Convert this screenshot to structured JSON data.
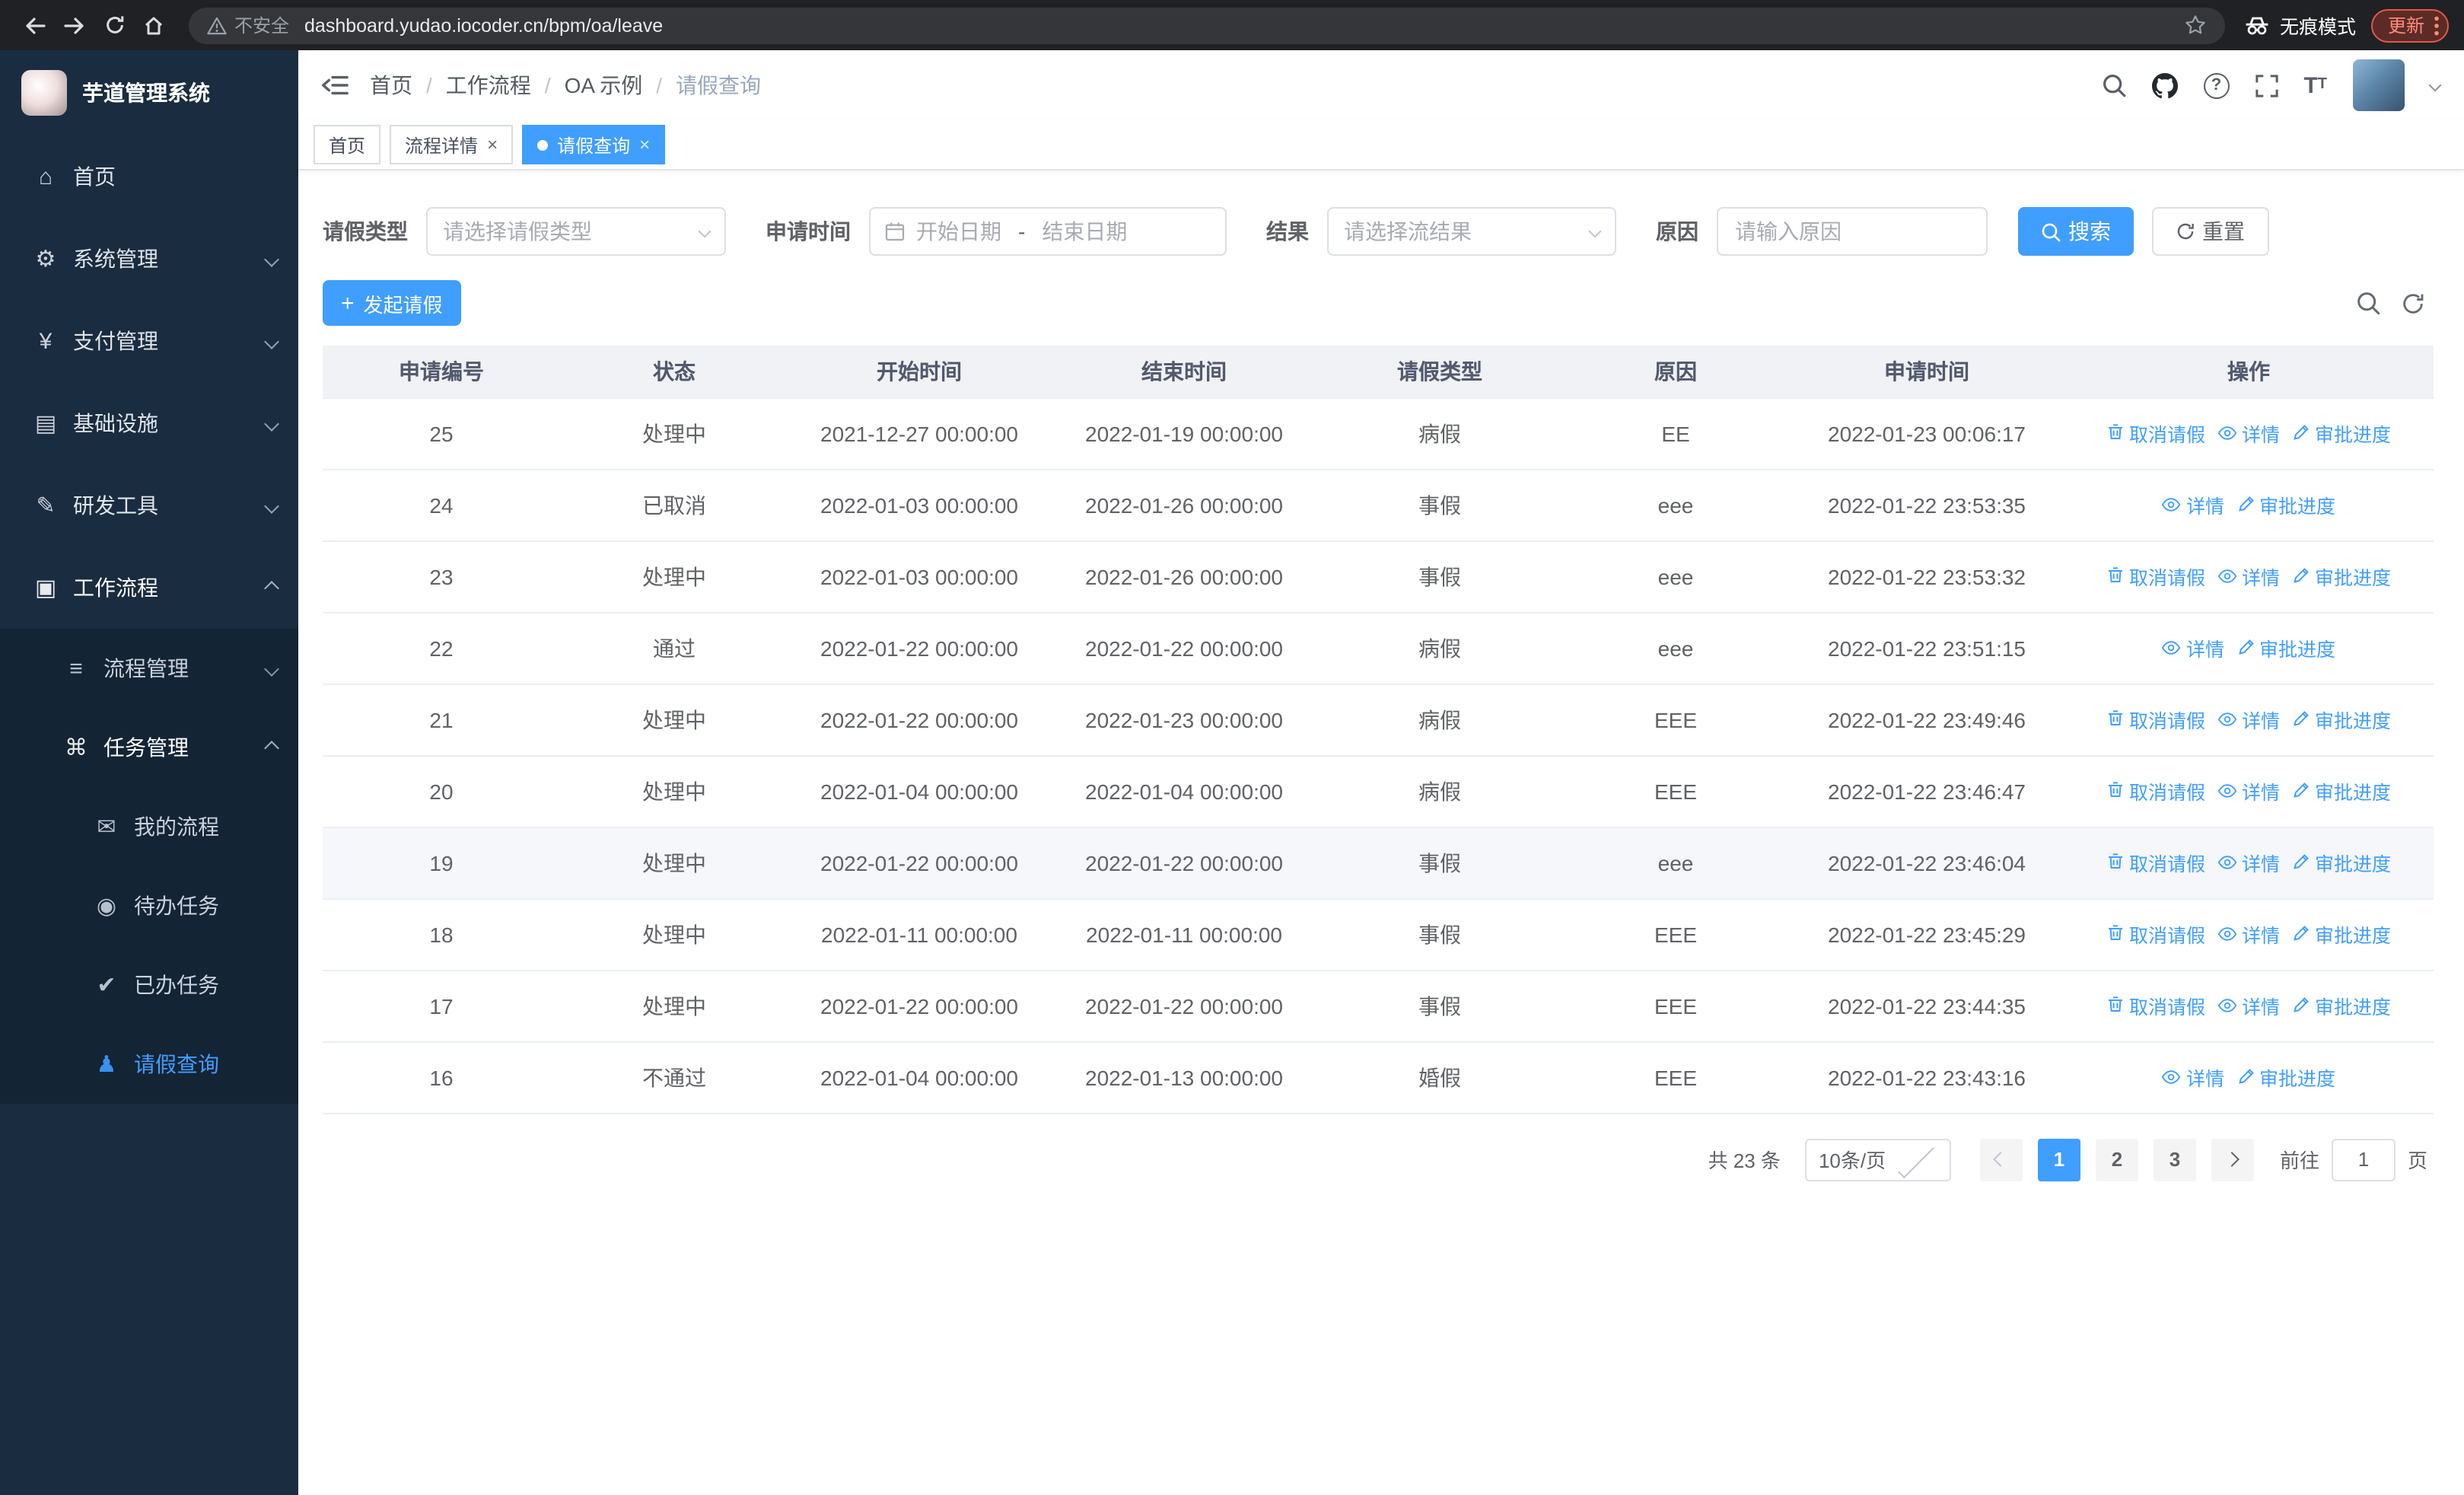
{
  "browser": {
    "security_warning": "不安全",
    "url": "dashboard.yudao.iocoder.cn/bpm/oa/leave",
    "incognito_label": "无痕模式",
    "update_label": "更新"
  },
  "sidebar": {
    "app_title": "芋道管理系统",
    "menu": [
      {
        "key": "home",
        "label": "首页",
        "icon": "home-icon",
        "level": 1
      },
      {
        "key": "system",
        "label": "系统管理",
        "icon": "gear-icon",
        "level": 1,
        "chevron": "down"
      },
      {
        "key": "payment",
        "label": "支付管理",
        "icon": "payment-icon",
        "level": 1,
        "chevron": "down"
      },
      {
        "key": "infra",
        "label": "基础设施",
        "icon": "infra-icon",
        "level": 1,
        "chevron": "down"
      },
      {
        "key": "devtools",
        "label": "研发工具",
        "icon": "devtools-icon",
        "level": 1,
        "chevron": "down"
      },
      {
        "key": "workflow",
        "label": "工作流程",
        "icon": "workflow-icon",
        "level": 1,
        "chevron": "up",
        "active_parent": true
      },
      {
        "key": "process-mgmt",
        "label": "流程管理",
        "icon": "process-icon",
        "level": 2,
        "chevron": "down",
        "in_submenu": true
      },
      {
        "key": "task-mgmt",
        "label": "任务管理",
        "icon": "task-icon",
        "level": 2,
        "chevron": "up",
        "in_submenu": true,
        "active_parent": true
      },
      {
        "key": "my-process",
        "label": "我的流程",
        "icon": "chat-icon",
        "level": 3,
        "in_submenu": true
      },
      {
        "key": "todo-tasks",
        "label": "待办任务",
        "icon": "eye-icon",
        "level": 3,
        "in_submenu": true
      },
      {
        "key": "done-tasks",
        "label": "已办任务",
        "icon": "check-icon",
        "level": 3,
        "in_submenu": true
      },
      {
        "key": "leave-query",
        "label": "请假查询",
        "icon": "user-icon",
        "level": 3,
        "in_submenu": true,
        "active": true
      }
    ]
  },
  "header": {
    "breadcrumb": [
      "首页",
      "工作流程",
      "OA 示例",
      "请假查询"
    ]
  },
  "tabs": [
    {
      "label": "首页",
      "closable": false,
      "active": false
    },
    {
      "label": "流程详情",
      "closable": true,
      "active": false
    },
    {
      "label": "请假查询",
      "closable": true,
      "active": true
    }
  ],
  "filters": {
    "leave_type_label": "请假类型",
    "leave_type_placeholder": "请选择请假类型",
    "apply_time_label": "申请时间",
    "start_placeholder": "开始日期",
    "range_separator": "-",
    "end_placeholder": "结束日期",
    "result_label": "结果",
    "result_placeholder": "请选择流结果",
    "reason_label": "原因",
    "reason_placeholder": "请输入原因",
    "search_label": "搜索",
    "reset_label": "重置"
  },
  "toolbar": {
    "create_label": "发起请假"
  },
  "table": {
    "columns": [
      "申请编号",
      "状态",
      "开始时间",
      "结束时间",
      "请假类型",
      "原因",
      "申请时间",
      "操作"
    ],
    "action_labels": {
      "cancel": "取消请假",
      "detail": "详情",
      "progress": "审批进度"
    },
    "rows": [
      {
        "id": "25",
        "status": "处理中",
        "start": "2021-12-27 00:00:00",
        "end": "2022-01-19 00:00:00",
        "type": "病假",
        "reason": "EE",
        "applied": "2022-01-23 00:06:17",
        "can_cancel": true,
        "highlighted": false
      },
      {
        "id": "24",
        "status": "已取消",
        "start": "2022-01-03 00:00:00",
        "end": "2022-01-26 00:00:00",
        "type": "事假",
        "reason": "eee",
        "applied": "2022-01-22 23:53:35",
        "can_cancel": false,
        "highlighted": false
      },
      {
        "id": "23",
        "status": "处理中",
        "start": "2022-01-03 00:00:00",
        "end": "2022-01-26 00:00:00",
        "type": "事假",
        "reason": "eee",
        "applied": "2022-01-22 23:53:32",
        "can_cancel": true,
        "highlighted": false
      },
      {
        "id": "22",
        "status": "通过",
        "start": "2022-01-22 00:00:00",
        "end": "2022-01-22 00:00:00",
        "type": "病假",
        "reason": "eee",
        "applied": "2022-01-22 23:51:15",
        "can_cancel": false,
        "highlighted": false
      },
      {
        "id": "21",
        "status": "处理中",
        "start": "2022-01-22 00:00:00",
        "end": "2022-01-23 00:00:00",
        "type": "病假",
        "reason": "EEE",
        "applied": "2022-01-22 23:49:46",
        "can_cancel": true,
        "highlighted": false
      },
      {
        "id": "20",
        "status": "处理中",
        "start": "2022-01-04 00:00:00",
        "end": "2022-01-04 00:00:00",
        "type": "病假",
        "reason": "EEE",
        "applied": "2022-01-22 23:46:47",
        "can_cancel": true,
        "highlighted": false
      },
      {
        "id": "19",
        "status": "处理中",
        "start": "2022-01-22 00:00:00",
        "end": "2022-01-22 00:00:00",
        "type": "事假",
        "reason": "eee",
        "applied": "2022-01-22 23:46:04",
        "can_cancel": true,
        "highlighted": true
      },
      {
        "id": "18",
        "status": "处理中",
        "start": "2022-01-11 00:00:00",
        "end": "2022-01-11 00:00:00",
        "type": "事假",
        "reason": "EEE",
        "applied": "2022-01-22 23:45:29",
        "can_cancel": true,
        "highlighted": false
      },
      {
        "id": "17",
        "status": "处理中",
        "start": "2022-01-22 00:00:00",
        "end": "2022-01-22 00:00:00",
        "type": "事假",
        "reason": "EEE",
        "applied": "2022-01-22 23:44:35",
        "can_cancel": true,
        "highlighted": false
      },
      {
        "id": "16",
        "status": "不通过",
        "start": "2022-01-04 00:00:00",
        "end": "2022-01-13 00:00:00",
        "type": "婚假",
        "reason": "EEE",
        "applied": "2022-01-22 23:43:16",
        "can_cancel": false,
        "highlighted": false
      }
    ]
  },
  "pagination": {
    "total_text": "共 23 条",
    "page_size_value": "10条/页",
    "pages": [
      "1",
      "2",
      "3"
    ],
    "active_page": "1",
    "goto_label": "前往",
    "goto_value": "1",
    "goto_unit": "页"
  },
  "colors": {
    "primary": "#409eff",
    "sidebar_bg": "#1a2c3f",
    "chrome_bg": "#202124"
  }
}
